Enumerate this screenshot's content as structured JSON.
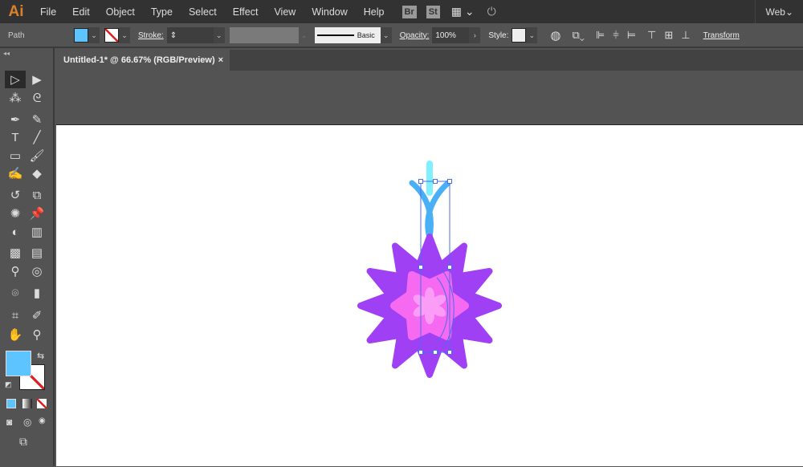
{
  "app": {
    "logo": "Ai",
    "menus": [
      "File",
      "Edit",
      "Object",
      "Type",
      "Select",
      "Effect",
      "View",
      "Window",
      "Help"
    ],
    "bridge": "Br",
    "stock": "St",
    "workspace": "Web"
  },
  "control": {
    "selection": "Path",
    "fill_color": "#5ec4ff",
    "stroke_label": "Stroke:",
    "brush": "Basic",
    "opacity_label": "Opacity:",
    "opacity": "100%",
    "style_label": "Style:",
    "transform": "Transform"
  },
  "document": {
    "tab_title": "Untitled-1* @ 66.67% (RGB/Preview)",
    "close": "×"
  },
  "tools": [
    "selection",
    "direct-selection",
    "magic-wand",
    "lasso",
    "pen",
    "curvature",
    "type",
    "line",
    "rectangle",
    "paintbrush",
    "shaper",
    "eraser",
    "rotate",
    "scale",
    "warp",
    "puppet-warp",
    "shape-builder",
    "perspective-grid",
    "mesh",
    "gradient",
    "eyedropper",
    "blend",
    "symbol-sprayer",
    "column-graph",
    "artboard",
    "slice",
    "hand",
    "zoom"
  ],
  "colors": {
    "fill": "#5ec4ff",
    "star_outer": "#a040f5",
    "star_inner": "#f56af0",
    "flower": "#fb9cf6",
    "stem": "#4ab0f5",
    "tip": "#7ff0ff",
    "selection": "#4a6cf0"
  }
}
